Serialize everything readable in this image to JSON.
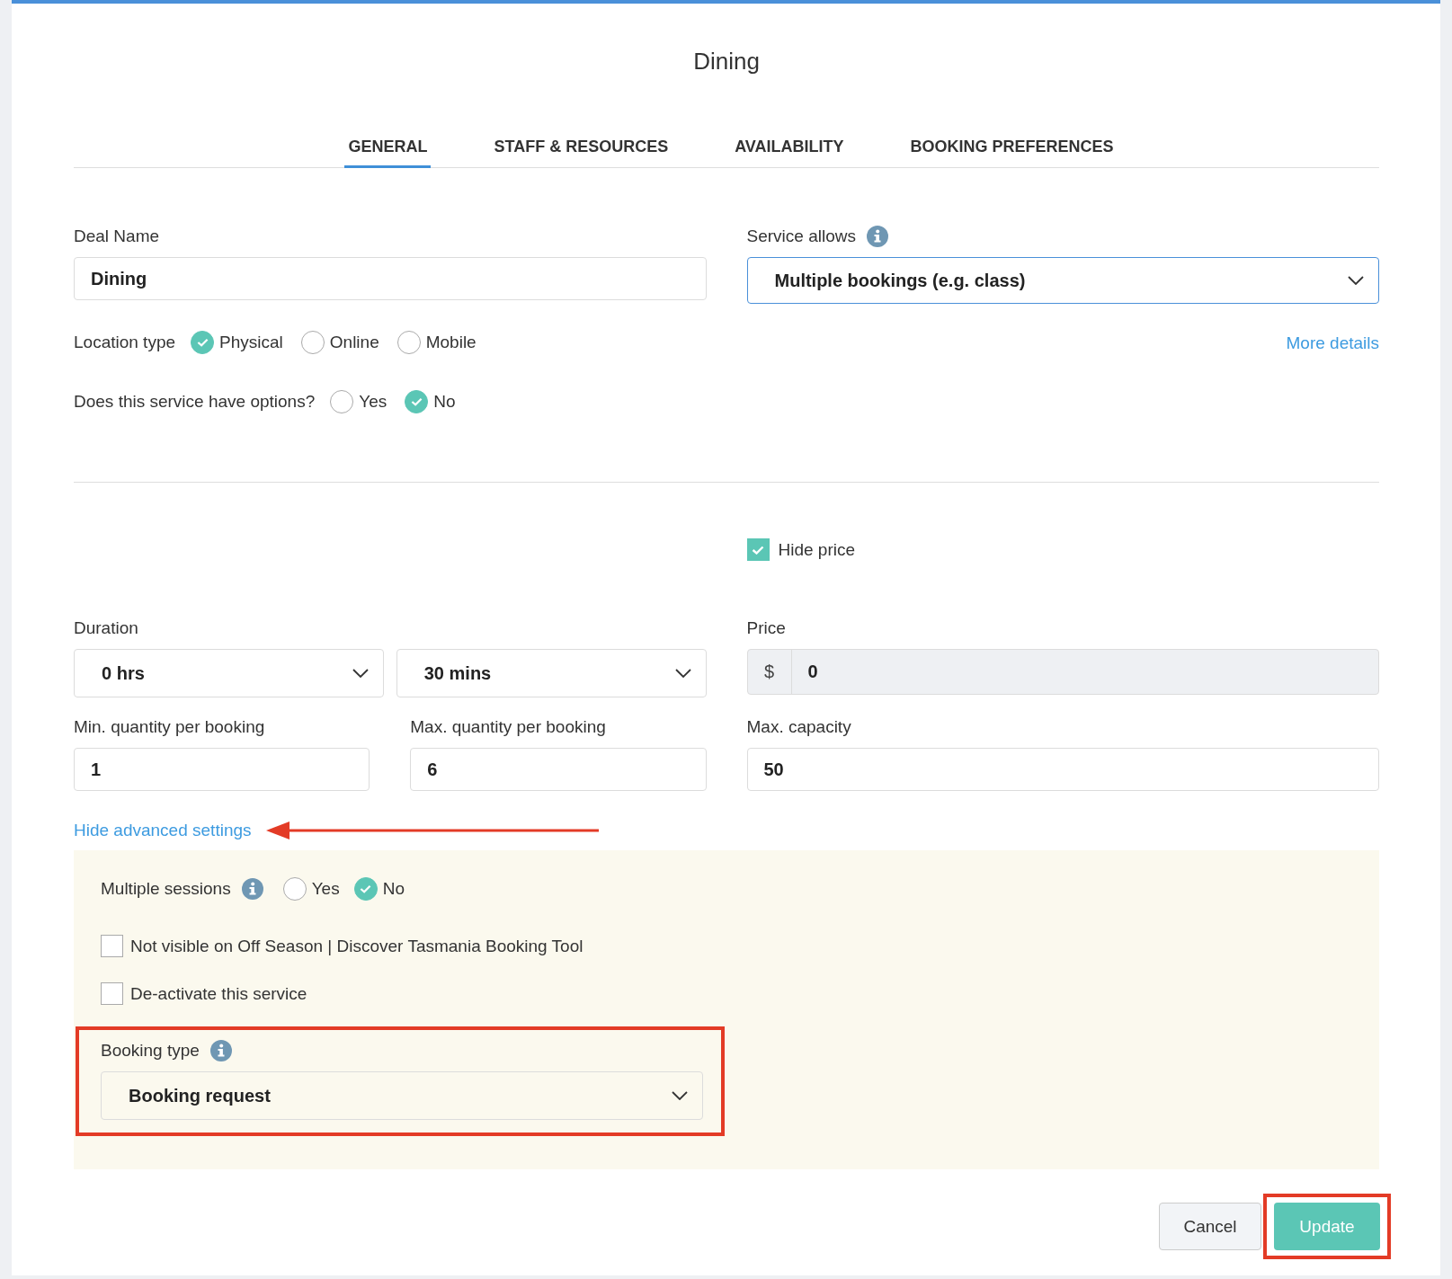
{
  "title": "Dining",
  "tabs": [
    {
      "label": "GENERAL",
      "selected": true
    },
    {
      "label": "STAFF & RESOURCES",
      "selected": false
    },
    {
      "label": "AVAILABILITY",
      "selected": false
    },
    {
      "label": "BOOKING PREFERENCES",
      "selected": false
    }
  ],
  "deal_name": {
    "label": "Deal Name",
    "value": "Dining"
  },
  "service_allows": {
    "label": "Service allows",
    "value": "Multiple bookings (e.g. class)",
    "link": "More details"
  },
  "location_type": {
    "label": "Location type",
    "options": [
      {
        "label": "Physical",
        "selected": true
      },
      {
        "label": "Online",
        "selected": false
      },
      {
        "label": "Mobile",
        "selected": false
      }
    ]
  },
  "has_options": {
    "label": "Does this service have options?",
    "options": [
      {
        "label": "Yes",
        "selected": false
      },
      {
        "label": "No",
        "selected": true
      }
    ]
  },
  "hide_price": {
    "label": "Hide price",
    "checked": true
  },
  "duration": {
    "label": "Duration",
    "hours": "0 hrs",
    "minutes": "30 mins"
  },
  "price": {
    "label": "Price",
    "currency": "$",
    "value": "0"
  },
  "quantities": [
    {
      "label": "Min. quantity per booking",
      "value": "1"
    },
    {
      "label": "Max. quantity per booking",
      "value": "6"
    }
  ],
  "max_capacity": {
    "label": "Max. capacity",
    "value": "50"
  },
  "advanced_toggle": "Hide advanced settings",
  "advanced": {
    "multiple_sessions": {
      "label": "Multiple sessions",
      "options": [
        {
          "label": "Yes",
          "selected": false
        },
        {
          "label": "No",
          "selected": true
        }
      ]
    },
    "checkboxes": [
      {
        "label": "Not visible on Off Season | Discover Tasmania Booking Tool",
        "checked": false
      },
      {
        "label": "De-activate this service",
        "checked": false
      }
    ],
    "booking_type": {
      "label": "Booking type",
      "value": "Booking request"
    }
  },
  "buttons": {
    "cancel": "Cancel",
    "update": "Update"
  }
}
